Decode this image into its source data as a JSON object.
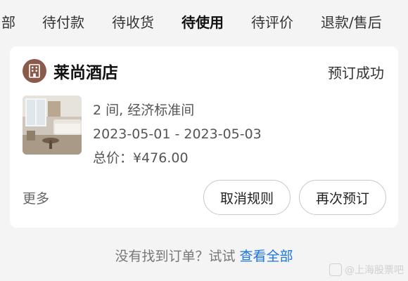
{
  "tabs": [
    {
      "label": "部",
      "active": false
    },
    {
      "label": "待付款",
      "active": false
    },
    {
      "label": "待收货",
      "active": false
    },
    {
      "label": "待使用",
      "active": true
    },
    {
      "label": "待评价",
      "active": false
    },
    {
      "label": "退款/售后",
      "active": false
    }
  ],
  "order": {
    "hotel_name": "莱尚酒店",
    "status": "预订成功",
    "room_line": "2 间, 经济标准间",
    "date_line": "2023-05-01 - 2023-05-03",
    "price_line": "总价：¥476.00",
    "more_label": "更多",
    "cancel_rules_label": "取消规则",
    "rebook_label": "再次预订"
  },
  "footer": {
    "hint": "没有找到订单？试试",
    "link": "查看全部"
  },
  "watermark": {
    "text": "@上海股票吧"
  },
  "colors": {
    "tab_underline": "#ffd21e",
    "hotel_logo_bg": "#8a5a4a",
    "link": "#1a73e8"
  },
  "icons": {
    "hotel_logo": "building-icon"
  }
}
